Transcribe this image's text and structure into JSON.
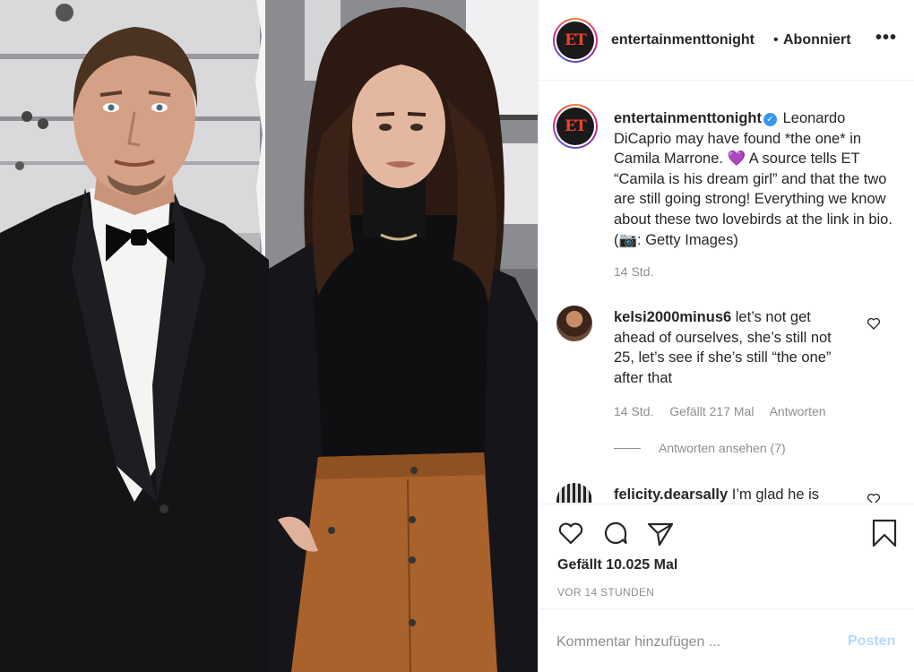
{
  "post": {
    "image_alt": "Leonardo DiCaprio and Camila Morrone"
  },
  "header": {
    "avatar_text": "ET",
    "username": "entertainmenttonight",
    "separator": "•",
    "follow_status": "Abonniert",
    "more": "•••"
  },
  "caption": {
    "avatar_text": "ET",
    "username": "entertainmenttonight",
    "verified_glyph": "✓",
    "text_1": "Leonardo DiCaprio may have found *the one* in Camila Marrone.",
    "heart": "💜",
    "text_2": "A source tells ET “Camila is his dream girl” and that the two are still going strong! Everything we know about these two lovebirds at the link in bio. (",
    "camera": "📷",
    "text_3": ": Getty Images)",
    "time": "14 Std."
  },
  "comments": [
    {
      "username": "kelsi2000minus6",
      "text": "let’s not get ahead of ourselves, she’s still not 25, let’s see if she’s still “the one” after that",
      "time": "14 Std.",
      "likes": "Gefällt 217 Mal",
      "reply": "Antworten",
      "view_replies": "Antworten ansehen (7)"
    },
    {
      "username": "felicity.dearsally",
      "text": "I’m glad he is"
    }
  ],
  "actions": {
    "likes_count": "Gefällt 10.025 Mal",
    "time_ago": "VOR 14 STUNDEN"
  },
  "add_comment": {
    "placeholder": "Kommentar hinzufügen ...",
    "post_label": "Posten"
  },
  "colors": {
    "link_blue_disabled": "#b3dbff",
    "verified_blue": "#3897f0",
    "secondary_text": "#8e8e8e",
    "primary_text": "#262626"
  }
}
